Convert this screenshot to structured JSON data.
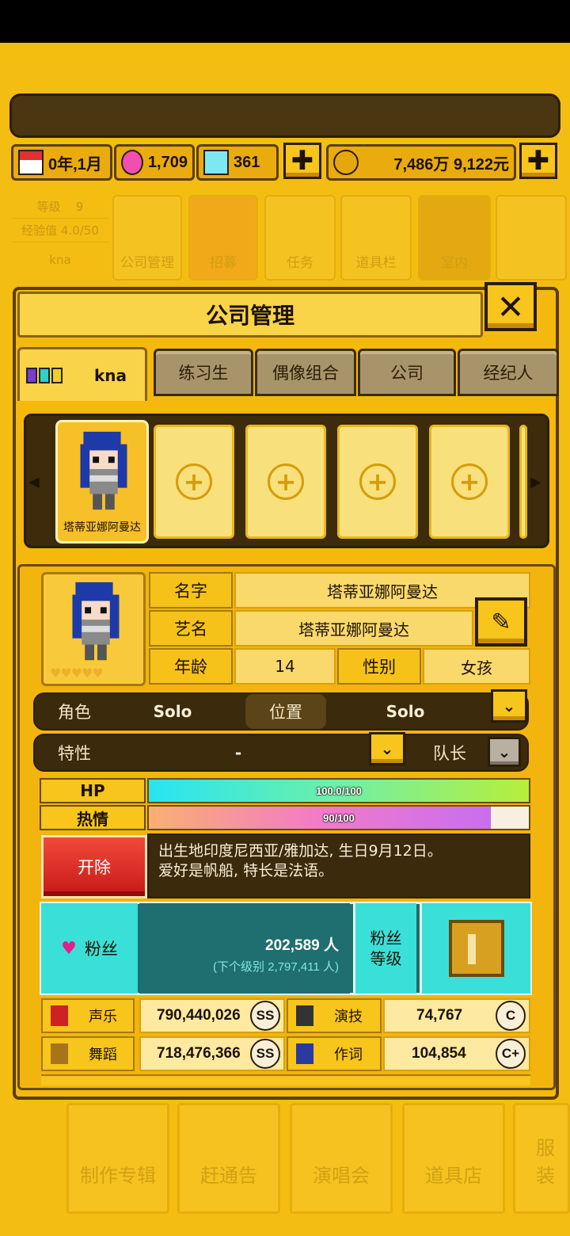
{
  "resources": {
    "date": "0年,1月",
    "pink_gems": "1,709",
    "diamonds": "361",
    "money": "7,486万 9,122元"
  },
  "background_nav": {
    "level_label": "等级",
    "level_value": "9",
    "exp_label": "经验值 4.0/50",
    "player_name": "kna",
    "items": [
      "公司管理",
      "招募",
      "任务",
      "道具栏",
      "室内"
    ]
  },
  "bottom_nav": [
    "制作专辑",
    "赶通告",
    "演唱会",
    "道具店",
    "服装"
  ],
  "modal": {
    "title": "公司管理",
    "close_label": "✕",
    "tabs": [
      "kna",
      "练习生",
      "偶像组合",
      "公司",
      "经纪人"
    ]
  },
  "roster": {
    "selected_name": "塔蒂亚娜阿曼达",
    "empty_slot_count": 4
  },
  "profile": {
    "name_label": "名字",
    "name_value": "塔蒂亚娜阿曼达",
    "stage_label": "艺名",
    "stage_value": "塔蒂亚娜阿曼达",
    "age_label": "年龄",
    "age_value": "14",
    "gender_label": "性别",
    "gender_value": "女孩",
    "role_label": "角色",
    "role_value": "Solo",
    "position_label": "位置",
    "position_value": "Solo",
    "trait_label": "特性",
    "trait_value": "-",
    "leader_label": "队长",
    "hearts": "♥♥♥♥♥",
    "edit_icon": "pencil-icon"
  },
  "bars": {
    "hp_label": "HP",
    "hp_text": "100.0/100",
    "hp_fraction": 1.0,
    "passion_label": "热情",
    "passion_text": "90/100",
    "passion_fraction": 0.9
  },
  "fire_label": "开除",
  "bio": {
    "line1": "出生地印度尼西亚/雅加达, 生日9月12日。",
    "line2": "爱好是帆船, 特长是法语。"
  },
  "fans": {
    "label": "粉丝",
    "count": "202,589 人",
    "next_level": "(下个级别 2,797,411 人)",
    "level_label_1": "粉丝",
    "level_label_2": "等级"
  },
  "stats": [
    {
      "label": "声乐",
      "value": "790,440,026",
      "grade": "SS",
      "icon": "microphone-icon"
    },
    {
      "label": "演技",
      "value": "74,767",
      "grade": "C",
      "icon": "camera-icon"
    },
    {
      "label": "舞蹈",
      "value": "718,476,366",
      "grade": "SS",
      "icon": "shoe-icon"
    },
    {
      "label": "作词",
      "value": "104,854",
      "grade": "C+",
      "icon": "pen-icon"
    }
  ],
  "colors": {
    "background": "#f3bd12",
    "panel_dark": "#3b2a0c",
    "fans_teal": "#3ae0d8",
    "fire_red": "#d42020"
  }
}
